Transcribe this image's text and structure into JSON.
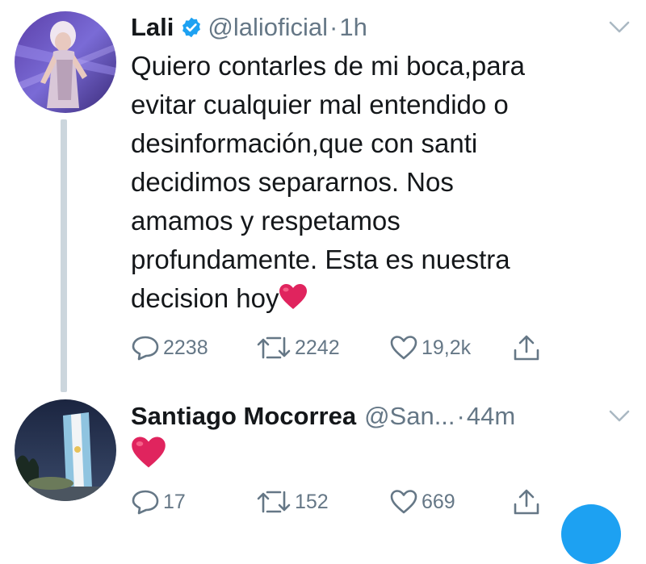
{
  "colors": {
    "text": "#14171a",
    "secondary": "#657786",
    "verified": "#1da1f2",
    "heart": "#e0245e"
  },
  "tweets": [
    {
      "author_name": "Lali",
      "verified": true,
      "handle": "@lalioficial",
      "separator": "·",
      "time": "1h",
      "lines": [
        "Quiero contarles de mi boca,para",
        "evitar cualquier mal entendido o",
        "desinformación,que con santi",
        "decidimos separarnos. Nos",
        "amamos y respetamos",
        "profundamente. Esta es nuestra",
        "decision hoy"
      ],
      "emoji": "red-heart",
      "replies": "2238",
      "retweets": "2242",
      "likes": "19,2k"
    },
    {
      "author_name": "Santiago Mocorrea",
      "verified": false,
      "handle": "@San...",
      "separator": "·",
      "time": "44m",
      "emoji": "red-heart",
      "replies": "17",
      "retweets": "152",
      "likes": "669"
    }
  ]
}
